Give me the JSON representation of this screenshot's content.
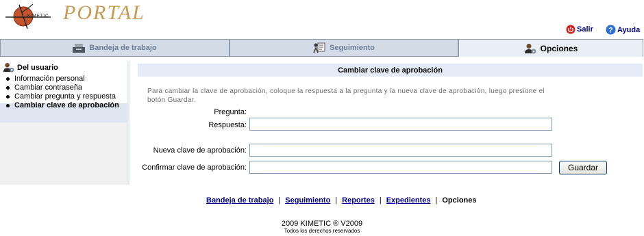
{
  "header": {
    "logo_text": "KIMETIC",
    "portal_title": "PORTAL",
    "salir_label": "Salir",
    "ayuda_label": "Ayuda"
  },
  "tabs": [
    {
      "label": "Bandeja de trabajo",
      "icon": "tray-icon",
      "active": false
    },
    {
      "label": "Seguimiento",
      "icon": "tracking-icon",
      "active": false
    },
    {
      "label": "Opciones",
      "icon": "user-options-icon",
      "active": true
    }
  ],
  "sidebar": {
    "title": "Del usuario",
    "items": [
      {
        "label": "Información personal"
      },
      {
        "label": "Cambiar contraseña"
      },
      {
        "label": "Cambiar pregunta y respuesta"
      },
      {
        "label": "Cambiar clave de aprobación",
        "selected": true
      }
    ]
  },
  "main": {
    "title": "Cambiar clave de aprobación",
    "instructions": "Para cambiar la clave de aprobación, coloque la respuesta a la pregunta y la nueva clave de aprobación, luego presione el botón Guardar.",
    "fields": {
      "pregunta_label": "Pregunta:",
      "pregunta_value": "",
      "respuesta_label": "Respuesta:",
      "respuesta_value": "",
      "nueva_label": "Nueva clave de aprobación:",
      "nueva_value": "",
      "confirmar_label": "Confirmar clave de aprobación:",
      "confirmar_value": ""
    },
    "save_label": "Guardar"
  },
  "footer": {
    "nav": [
      "Bandeja de trabajo",
      "Seguimiento",
      "Reportes",
      "Expedientes",
      "Opciones"
    ],
    "copyright": "2009 KIMETIC ®  V2009",
    "rights": "Todos los derechos reservados"
  },
  "colors": {
    "accent_link": "#00008b",
    "tab_bg": "#d3dbe6",
    "active_tab_bg": "#e9eef7",
    "title_bar": "#e4ebf7",
    "portal_gold": "#c89a52"
  }
}
